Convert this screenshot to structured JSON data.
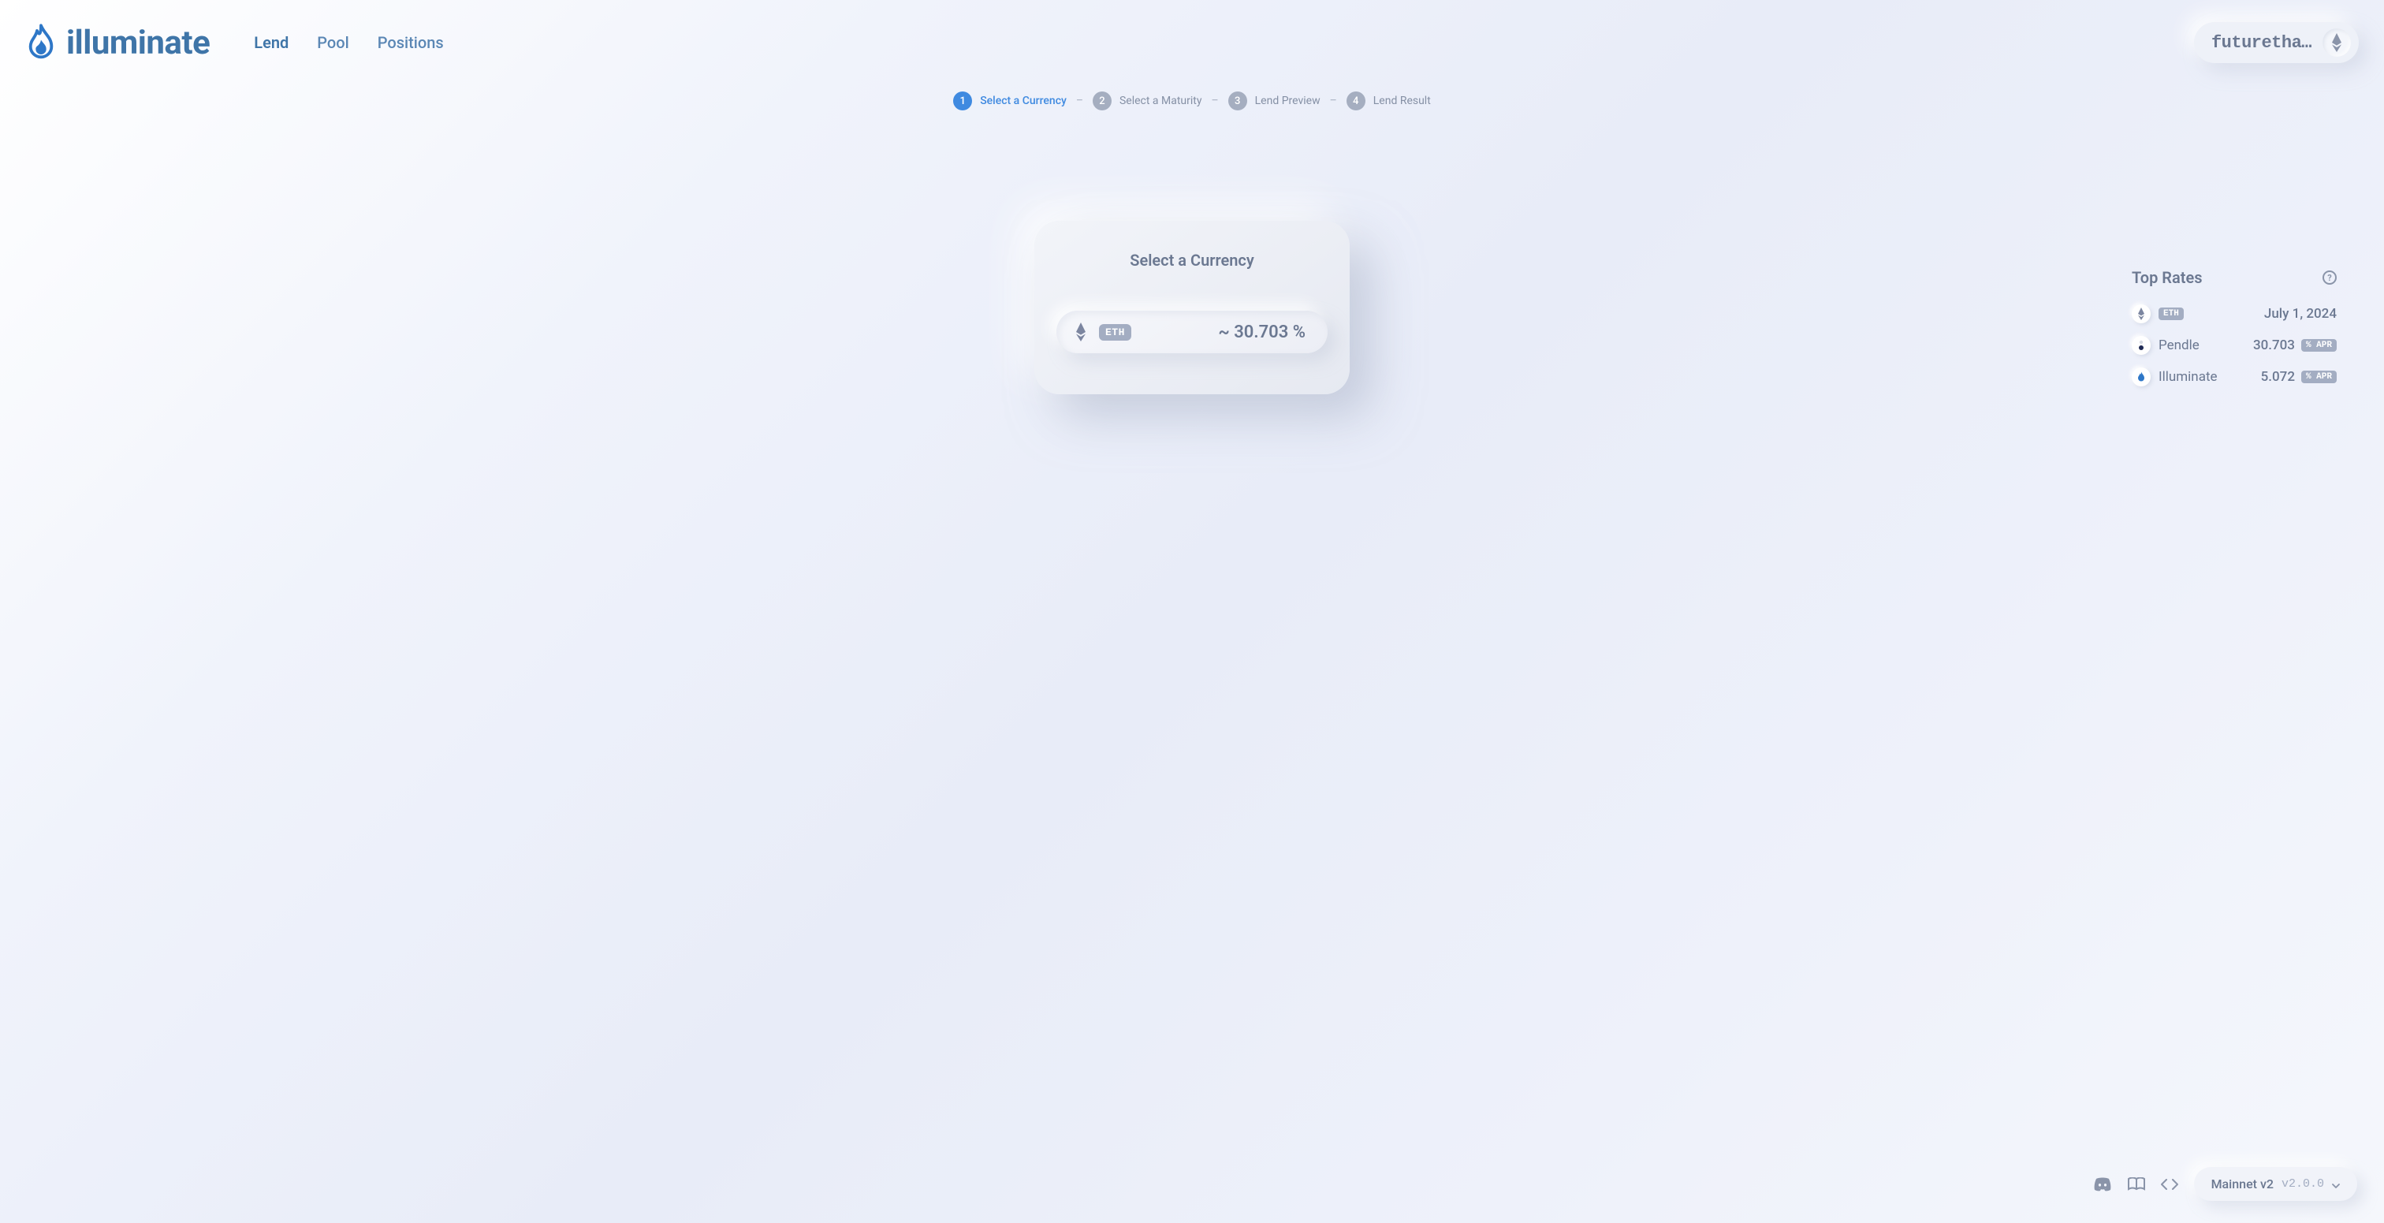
{
  "brand": {
    "name": "illuminate"
  },
  "nav": {
    "lend": "Lend",
    "pool": "Pool",
    "positions": "Positions"
  },
  "wallet": {
    "display": "futuretha…"
  },
  "stepper": {
    "s1": {
      "num": "1",
      "label": "Select a Currency"
    },
    "s2": {
      "num": "2",
      "label": "Select a Maturity"
    },
    "s3": {
      "num": "3",
      "label": "Lend Preview"
    },
    "s4": {
      "num": "4",
      "label": "Lend Result"
    }
  },
  "card": {
    "title": "Select a Currency",
    "currency": {
      "badge": "ETH",
      "rate": "~ 30.703 %"
    }
  },
  "rates": {
    "title": "Top Rates",
    "maturity": {
      "badge": "ETH",
      "date": "July 1, 2024"
    },
    "rows": [
      {
        "name": "Pendle",
        "value": "30.703",
        "unit": "% APR"
      },
      {
        "name": "Illuminate",
        "value": "5.072",
        "unit": "% APR"
      }
    ]
  },
  "footer": {
    "version_name": "Mainnet v2",
    "version_tag": "v2.0.0"
  }
}
